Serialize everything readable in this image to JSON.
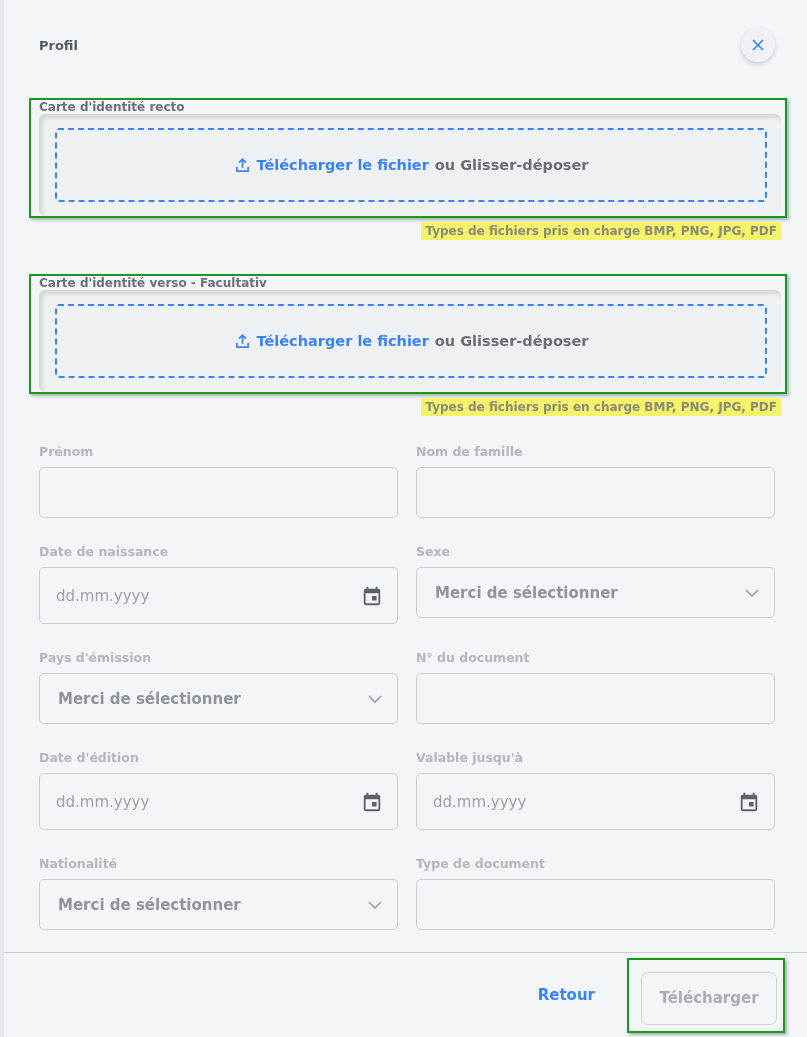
{
  "title": "Profil",
  "uploads": [
    {
      "label": "Carte d'identité recto",
      "link": "Télécharger le fichier",
      "rest": "ou Glisser-déposer",
      "hint": "Types de fichiers pris en charge BMP, PNG, JPG, PDF",
      "outlined": true,
      "highlighted": true
    },
    {
      "label": "Carte d'identité verso - Facultativ",
      "link": "Télécharger le fichier",
      "rest": "ou Glisser-déposer",
      "hint": "Types de fichiers pris en charge BMP, PNG, JPG, PDF",
      "outlined": true,
      "highlighted": true
    }
  ],
  "fields": [
    {
      "label": "Prénom",
      "kind": "text"
    },
    {
      "label": "Nom de famille",
      "kind": "text"
    },
    {
      "label": "Date de naissance",
      "kind": "date",
      "placeholder": "dd.mm.yyyy"
    },
    {
      "label": "Sexe",
      "kind": "select",
      "value": "Merci de sélectionner"
    },
    {
      "label": "Pays d'émission",
      "kind": "select",
      "value": "Merci de sélectionner"
    },
    {
      "label": "N° du document",
      "kind": "text"
    },
    {
      "label": "Date d'édition",
      "kind": "date",
      "placeholder": "dd.mm.yyyy"
    },
    {
      "label": "Valable jusqu'à",
      "kind": "date",
      "placeholder": "dd.mm.yyyy"
    },
    {
      "label": "Nationalité",
      "kind": "select",
      "value": "Merci de sélectionner"
    },
    {
      "label": "Type de document",
      "kind": "text"
    }
  ],
  "footer": {
    "back": "Retour",
    "submit": {
      "label": "Télécharger",
      "disabled": true,
      "outlined": true
    }
  }
}
